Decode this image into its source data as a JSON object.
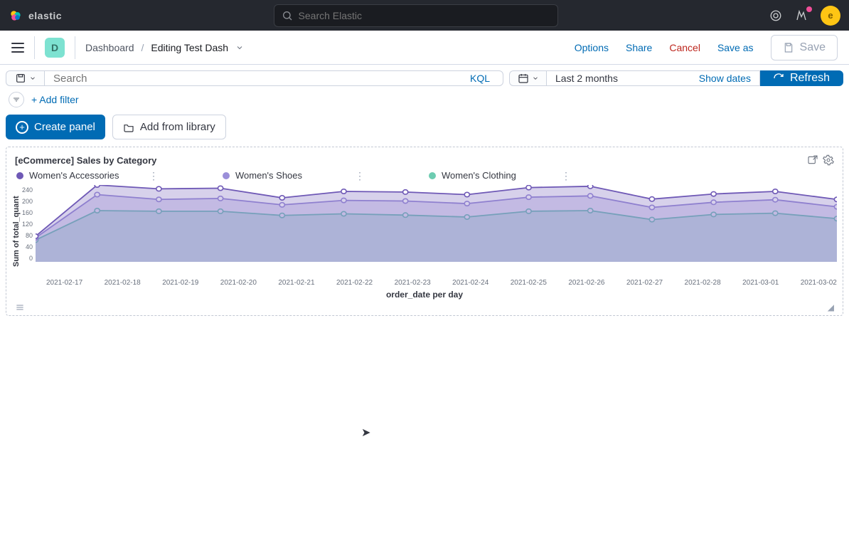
{
  "brand": {
    "name": "elastic"
  },
  "search_global": {
    "placeholder": "Search Elastic"
  },
  "avatar_letter": "e",
  "space_badge": "D",
  "breadcrumbs": {
    "section": "Dashboard",
    "current": "Editing Test Dash"
  },
  "header_actions": {
    "options": "Options",
    "share": "Share",
    "cancel": "Cancel",
    "save_as": "Save as",
    "save": "Save"
  },
  "querybar": {
    "search_placeholder": "Search",
    "kql": "KQL",
    "date_range": "Last 2 months",
    "show_dates": "Show dates",
    "refresh": "Refresh"
  },
  "filter_row": {
    "add_filter": "+ Add filter"
  },
  "actions": {
    "create_panel": "Create panel",
    "add_from_library": "Add from library"
  },
  "panel": {
    "title": "[eCommerce] Sales by Category",
    "legend": [
      "Women's Accessories",
      "Women's Shoes",
      "Women's Clothing"
    ],
    "xlabel": "order_date per day",
    "ylabel": "Sum of total_quant"
  },
  "chart_data": {
    "type": "area",
    "xlabel": "order_date per day",
    "ylabel": "Sum of total_quant",
    "ylim": [
      0,
      240
    ],
    "yticks": [
      240,
      200,
      160,
      120,
      80,
      40,
      0
    ],
    "categories": [
      "2021-02-17",
      "2021-02-18",
      "2021-02-19",
      "2021-02-20",
      "2021-02-21",
      "2021-02-22",
      "2021-02-23",
      "2021-02-24",
      "2021-02-25",
      "2021-02-26",
      "2021-02-27",
      "2021-02-28",
      "2021-03-01",
      "2021-03-02"
    ],
    "series": [
      {
        "name": "Women's Accessories",
        "color": "#6f59b6",
        "values": [
          80,
          240,
          228,
          230,
          200,
          220,
          218,
          210,
          232,
          236,
          196,
          212,
          220,
          195
        ]
      },
      {
        "name": "Women's Shoes",
        "color": "#9b8fd9",
        "values": [
          75,
          210,
          195,
          198,
          178,
          192,
          190,
          182,
          202,
          206,
          170,
          186,
          194,
          172
        ]
      },
      {
        "name": "Women's Clothing",
        "color": "#6dccb1",
        "values": [
          68,
          160,
          158,
          158,
          145,
          150,
          146,
          140,
          158,
          160,
          132,
          148,
          152,
          135
        ]
      }
    ]
  }
}
